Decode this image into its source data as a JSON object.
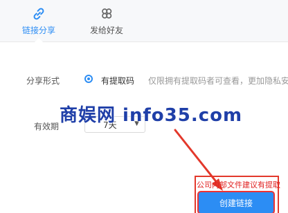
{
  "tabs": [
    {
      "label": "链接分享",
      "icon": "link-icon",
      "active": true
    },
    {
      "label": "发给好友",
      "icon": "friends-icon",
      "active": false
    }
  ],
  "share_form": {
    "label": "分享形式",
    "option_label": "有提取码",
    "option_desc": "仅限拥有提取码者可查看，更加隐私安"
  },
  "validity": {
    "label": "有效期",
    "selected": "7天"
  },
  "watermark": "商娱网 info35.com",
  "notice": "公司内部文件建议有提取",
  "create_button": "创建链接",
  "colors": {
    "accent": "#2c8df4",
    "annotation": "#e3382b"
  }
}
